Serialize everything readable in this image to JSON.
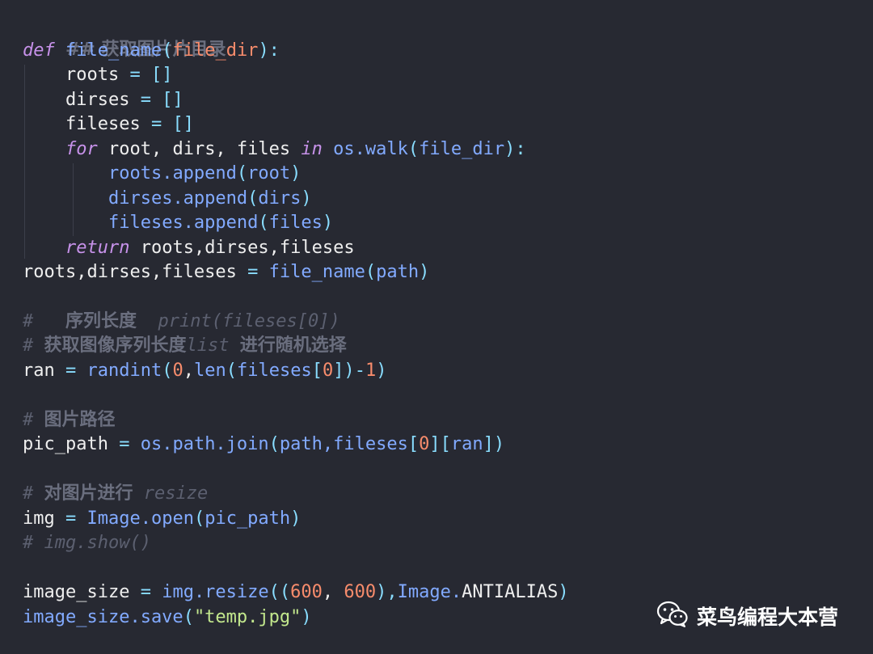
{
  "code": {
    "l1_comment": "## 获取图片片目录",
    "l2": {
      "def": "def",
      "name": "file_name",
      "open": "(",
      "param": "file_dir",
      "close": "):"
    },
    "l3": {
      "var": "roots",
      "eq": "=",
      "val": "[]"
    },
    "l4": {
      "var": "dirses",
      "eq": "=",
      "val": "[]"
    },
    "l5": {
      "var": "fileses",
      "eq": "=",
      "val": "[]"
    },
    "l6": {
      "for": "for",
      "vars": "root, dirs, files",
      "in": "in",
      "call": "os.walk",
      "open": "(",
      "arg": "file_dir",
      "close": "):"
    },
    "l7": {
      "call": "roots.append",
      "open": "(",
      "arg": "root",
      "close": ")"
    },
    "l8": {
      "call": "dirses.append",
      "open": "(",
      "arg": "dirs",
      "close": ")"
    },
    "l9": {
      "call": "fileses.append",
      "open": "(",
      "arg": "files",
      "close": ")"
    },
    "l10": {
      "ret": "return",
      "vals": "roots,dirses,fileses"
    },
    "l11": {
      "lhs": "roots,dirses,fileses",
      "eq": "=",
      "call": "file_name",
      "open": "(",
      "arg": "path",
      "close": ")"
    },
    "l12": {
      "hash": "#",
      "cn": "序列长度",
      "code": "print(fileses[0])"
    },
    "l13": {
      "hash": "#",
      "cn1": "获取图像序列长度",
      "code": "list",
      "cn2": "进行随机选择"
    },
    "l14": {
      "lhs": "ran",
      "eq": "=",
      "call": "randint",
      "open": "(",
      "n0": "0",
      "comma": ",",
      "len": "len",
      "open2": "(",
      "arg": "fileses",
      "br_open": "[",
      "idx": "0",
      "br_close": "])",
      "minus": "-",
      "n1": "1",
      "close": ")"
    },
    "l15": {
      "hash": "#",
      "cn": "图片路径"
    },
    "l16": {
      "lhs": "pic_path",
      "eq": "=",
      "call": "os.path.join",
      "open": "(",
      "arg1": "path,",
      "arg2": "fileses",
      "br1": "[",
      "idx": "0",
      "br2": "][",
      "ran": "ran",
      "close": "])"
    },
    "l17": {
      "hash": "#",
      "cn": "对图片进行",
      "code": "resize"
    },
    "l18": {
      "lhs": "img",
      "eq": "=",
      "call": "Image.open",
      "open": "(",
      "arg": "pic_path",
      "close": ")"
    },
    "l19": {
      "comment": "# img.show()"
    },
    "l20": {
      "lhs": "image_size",
      "eq": "=",
      "call": "img.resize",
      "open": "((",
      "n1": "600",
      "sep": ", ",
      "n2": "600",
      "mid": "),",
      "cls": "Image.",
      "const": "ANTIALIAS",
      "close": ")"
    },
    "l21": {
      "call": "image_size.save",
      "open": "(",
      "str": "\"temp.jpg\"",
      "close": ")"
    }
  },
  "watermark": {
    "text": "菜鸟编程大本营",
    "icon": "wechat-icon"
  }
}
